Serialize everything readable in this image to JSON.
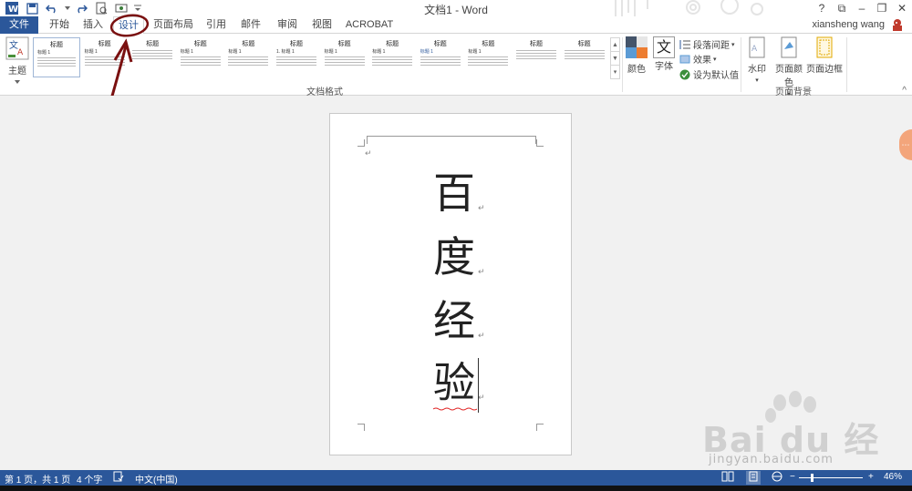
{
  "window": {
    "title": "文档1 - Word",
    "user": "xiansheng wang",
    "help": "?",
    "controls": {
      "ribbon_options": "⧉",
      "minimize": "–",
      "restore": "❐",
      "close": "✕"
    }
  },
  "qat": {
    "items": [
      "word-logo-icon",
      "save-icon",
      "undo-icon",
      "redo-icon",
      "print-preview-icon",
      "touch-mode-icon",
      "customize-qat-icon"
    ]
  },
  "tabs": {
    "file": "文件",
    "items": [
      "开始",
      "插入",
      "设计",
      "页面布局",
      "引用",
      "邮件",
      "审阅",
      "视图",
      "ACROBAT"
    ],
    "active": "设计"
  },
  "ribbon": {
    "theme_label": "主题",
    "style_thumbs": [
      {
        "heading": "标题",
        "sub": "标题 1"
      },
      {
        "heading": "标题",
        "sub": "标题 1"
      },
      {
        "heading": "标题",
        "sub": ""
      },
      {
        "heading": "标题",
        "sub": "标题 1"
      },
      {
        "heading": "标题",
        "sub": "标题 1"
      },
      {
        "heading": "标题",
        "sub": "1. 标题 1"
      },
      {
        "heading": "标题",
        "sub": "标题 1"
      },
      {
        "heading": "标题",
        "sub": "标题 1"
      },
      {
        "heading": "标题",
        "sub": "标题 1"
      },
      {
        "heading": "标题",
        "sub": "标题 1"
      },
      {
        "heading": "标题",
        "sub": ""
      },
      {
        "heading": "标题",
        "sub": ""
      }
    ],
    "group_document_format": "文档格式",
    "colors_label": "颜色",
    "fonts_label": "字体",
    "fonts_glyph": "文",
    "paragraph_spacing": "段落间距",
    "effects": "效果",
    "set_default": "设为默认值",
    "watermark": "水印",
    "page_color": "页面颜色",
    "page_borders": "页面边框",
    "group_page_background": "页面背景",
    "collapse": "^"
  },
  "document": {
    "lines": [
      "百",
      "度",
      "经",
      "验"
    ],
    "para_mark": "↵"
  },
  "watermark_logo": {
    "text": "Bai du 经验",
    "url": "jingyan.baidu.com"
  },
  "statusbar": {
    "page": "第 1 页，共 1 页",
    "words": "4 个字",
    "language": "中文(中国)",
    "zoom": "46%",
    "zoom_minus": "−",
    "zoom_plus": "+",
    "zoom_value": 0.46
  },
  "colors": {
    "accent": "#2b579a",
    "annotation": "#7a1010"
  }
}
